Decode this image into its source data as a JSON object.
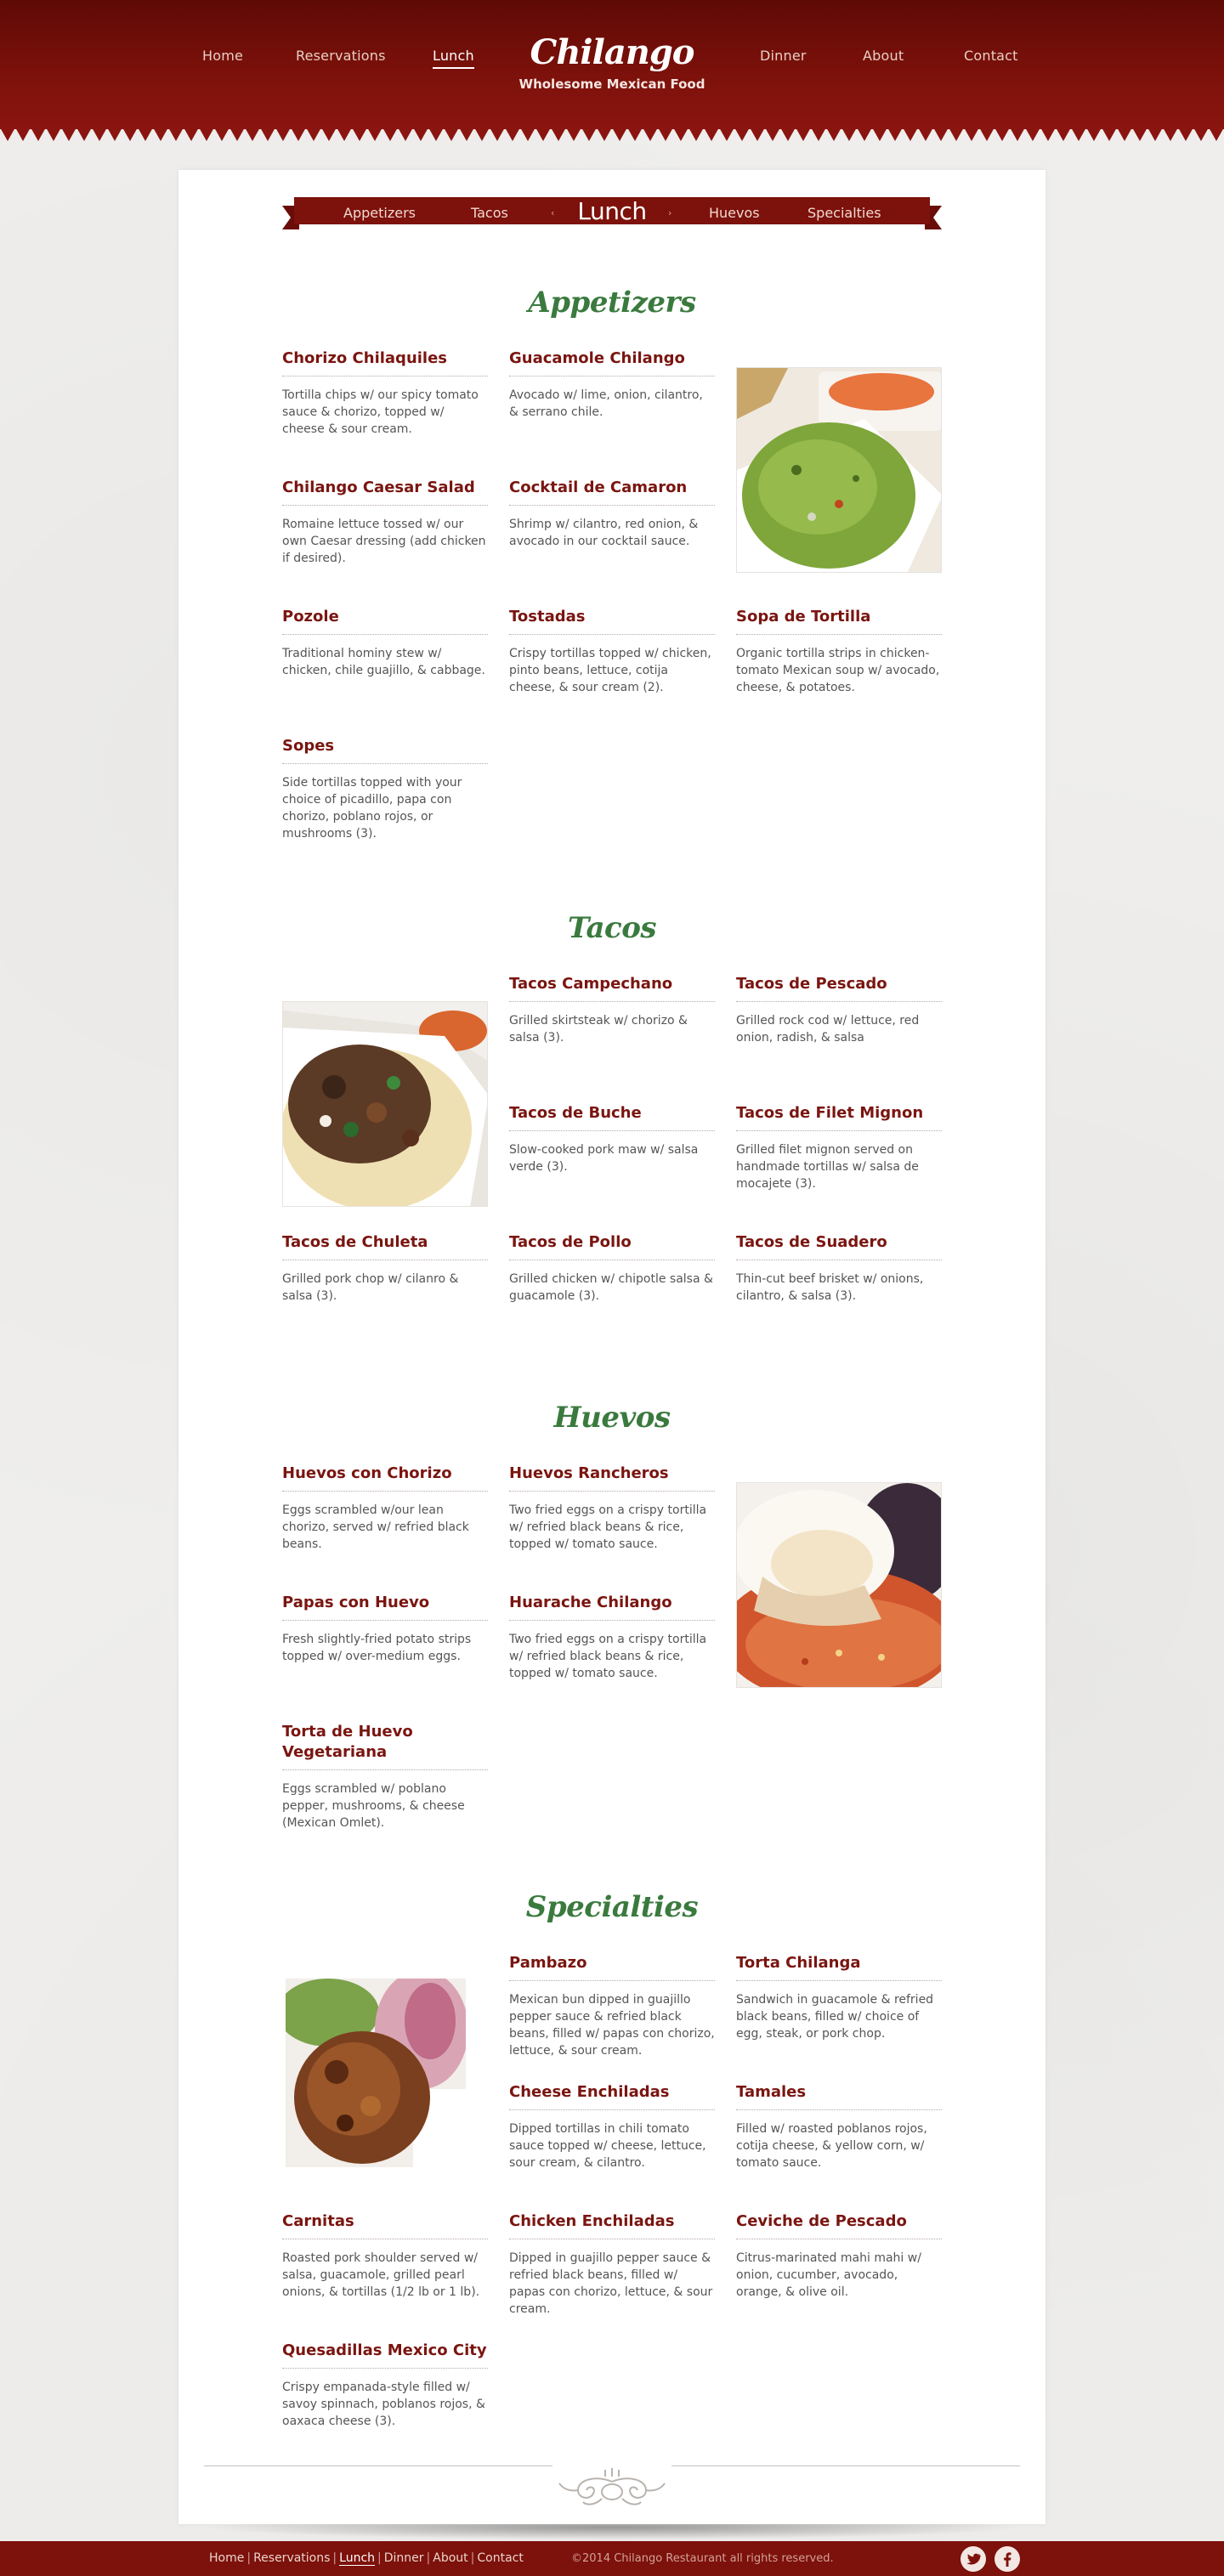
{
  "brand": {
    "name": "Chilango",
    "tagline": "Wholesome Mexican Food"
  },
  "nav": {
    "items": [
      {
        "label": "Home",
        "active": false
      },
      {
        "label": "Reservations",
        "active": false
      },
      {
        "label": "Lunch",
        "active": true
      },
      {
        "label": "Dinner",
        "active": false
      },
      {
        "label": "About",
        "active": false
      },
      {
        "label": "Contact",
        "active": false
      }
    ]
  },
  "submenu": {
    "title": "Lunch",
    "items": [
      "Appetizers",
      "Tacos",
      "Huevos",
      "Specialties"
    ]
  },
  "sections": [
    {
      "title": "Appetizers",
      "image": "guacamole-photo",
      "items": [
        {
          "name": "Chorizo Chilaquiles",
          "desc": "Tortilla chips w/ our spicy tomato sauce & chorizo, topped w/ cheese & sour cream."
        },
        {
          "name": "Guacamole Chilango",
          "desc": "Avocado w/ lime, onion, cilantro, & serrano chile."
        },
        {
          "name": "Chilango Caesar Salad",
          "desc": "Romaine lettuce tossed w/ our own Caesar dressing (add chicken if desired)."
        },
        {
          "name": "Cocktail de Camaron",
          "desc": "Shrimp w/ cilantro, red onion, & avocado in our cocktail sauce."
        },
        {
          "name": "Pozole",
          "desc": "Traditional hominy stew w/ chicken, chile guajillo, & cabbage."
        },
        {
          "name": "Tostadas",
          "desc": "Crispy tortillas topped w/ chicken, pinto beans, lettuce, cotija cheese, & sour cream (2)."
        },
        {
          "name": "Sopa de Tortilla",
          "desc": "Organic tortilla strips in chicken-tomato Mexican soup w/ avocado, cheese, & potatoes."
        },
        {
          "name": "Sopes",
          "desc": "Side tortillas topped with your choice of picadillo, papa con chorizo, poblano rojos, or mushrooms (3)."
        }
      ]
    },
    {
      "title": "Tacos",
      "image": "tacos-photo",
      "items": [
        {
          "name": "Tacos Campechano",
          "desc": "Grilled skirtsteak w/ chorizo & salsa (3)."
        },
        {
          "name": "Tacos de Pescado",
          "desc": "Grilled rock cod w/ lettuce, red onion, radish, & salsa"
        },
        {
          "name": "Tacos de Buche",
          "desc": "Slow-cooked pork maw w/ salsa verde (3)."
        },
        {
          "name": "Tacos de Filet Mignon",
          "desc": "Grilled filet mignon served on handmade tortillas w/ salsa de mocajete (3)."
        },
        {
          "name": "Tacos de Chuleta",
          "desc": "Grilled pork chop w/ cilanro & salsa (3)."
        },
        {
          "name": "Tacos de Pollo",
          "desc": "Grilled chicken w/ chipotle salsa & guacamole (3)."
        },
        {
          "name": "Tacos de Suadero",
          "desc": "Thin-cut beef brisket w/ onions, cilantro, & salsa (3)."
        }
      ]
    },
    {
      "title": "Huevos",
      "image": "huevos-photo",
      "items": [
        {
          "name": "Huevos con Chorizo",
          "desc": "Eggs scrambled w/our lean chorizo, served w/ refried black beans."
        },
        {
          "name": "Huevos Rancheros",
          "desc": "Two fried eggs on a crispy tortilla w/ refried black beans & rice, topped w/ tomato sauce."
        },
        {
          "name": "Papas con Huevo",
          "desc": "Fresh slightly-fried potato strips topped w/ over-medium eggs."
        },
        {
          "name": "Huarache Chilango",
          "desc": "Two fried eggs on a crispy tortilla w/ refried black beans & rice, topped w/ tomato sauce."
        },
        {
          "name": "Torta de Huevo Vegetariana",
          "desc": "Eggs scrambled w/ poblano pepper, mushrooms, & cheese (Mexican Omlet)."
        }
      ]
    },
    {
      "title": "Specialties",
      "image": "carnitas-photo",
      "items": [
        {
          "name": "Pambazo",
          "desc": "Mexican bun dipped in guajillo pepper sauce & refried black beans, filled w/ papas con chorizo, lettuce, & sour cream."
        },
        {
          "name": "Torta Chilanga",
          "desc": "Sandwich in guacamole & refried black beans, filled w/ choice of egg, steak, or pork chop."
        },
        {
          "name": "Cheese Enchiladas",
          "desc": "Dipped tortillas in chili tomato sauce topped w/ cheese, lettuce, sour cream, & cilantro."
        },
        {
          "name": "Tamales",
          "desc": "Filled w/ roasted poblanos rojos, cotija cheese, & yellow corn, w/ tomato sauce."
        },
        {
          "name": "Carnitas",
          "desc": "Roasted pork shoulder served w/ salsa, guacamole, grilled pearl onions, & tortillas (1/2 lb or 1 lb)."
        },
        {
          "name": "Chicken Enchiladas",
          "desc": "Dipped in guajillo pepper sauce & refried black beans, filled w/ papas con chorizo, lettuce, & sour cream."
        },
        {
          "name": "Ceviche de Pescado",
          "desc": "Citrus-marinated mahi mahi w/ onion, cucumber, avocado, orange, & olive oil."
        },
        {
          "name": "Quesadillas Mexico City",
          "desc": "Crispy empanada-style filled w/ savoy spinnach, poblanos rojos, & oaxaca cheese (3)."
        }
      ]
    }
  ],
  "footer": {
    "nav": [
      "Home",
      "Reservations",
      "Lunch",
      "Dinner",
      "About",
      "Contact"
    ],
    "active": "Lunch",
    "copyright": "©2014 Chilango Restaurant all rights reserved.",
    "social": [
      "twitter-icon",
      "facebook-icon"
    ]
  },
  "colors": {
    "brand_red": "#7d110b",
    "section_green": "#3a7a3e",
    "item_red": "#7a1510"
  }
}
